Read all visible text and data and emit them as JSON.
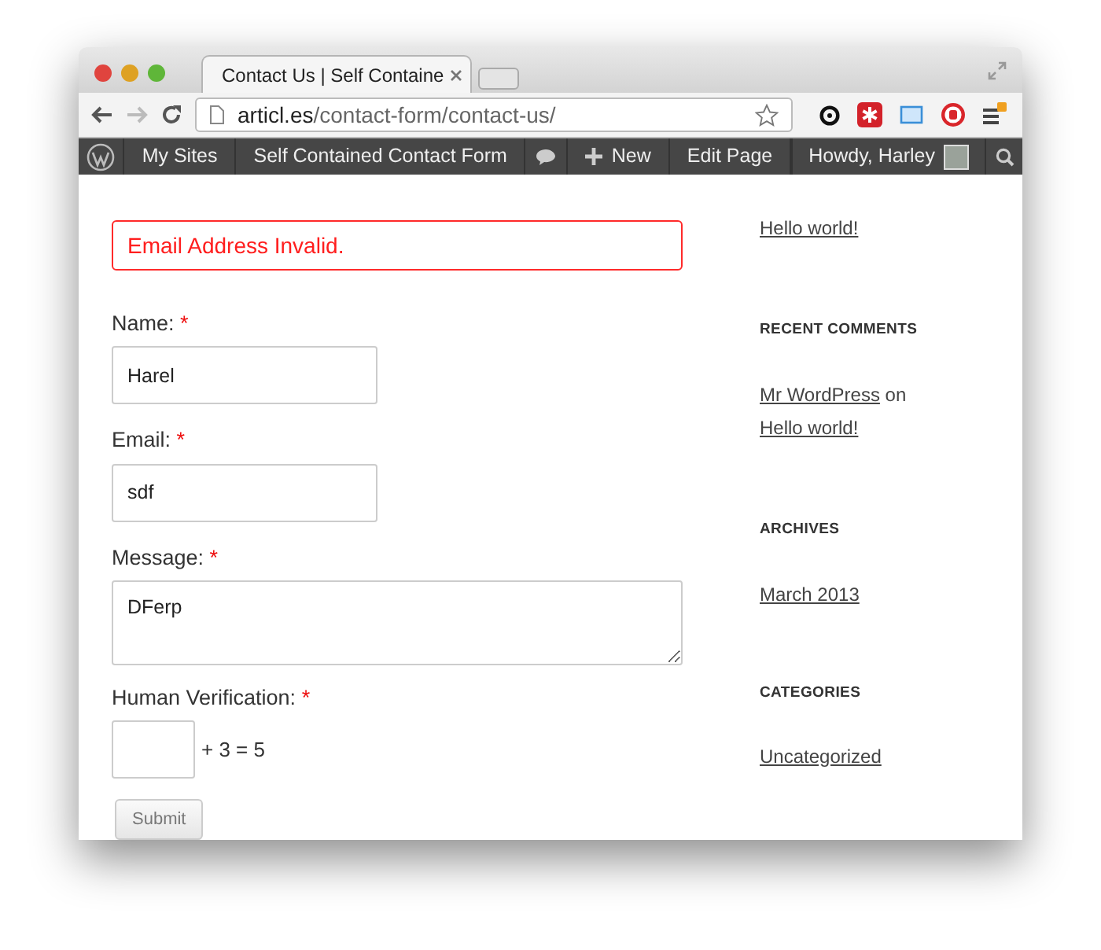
{
  "browser": {
    "tab_title": "Contact Us | Self Containe",
    "url_host": "articl.es",
    "url_path": "/contact-form/contact-us/"
  },
  "admin_bar": {
    "items": [
      {
        "kind": "logo"
      },
      {
        "kind": "text",
        "label": "My Sites"
      },
      {
        "kind": "text",
        "label": "Self Contained Contact Form"
      },
      {
        "kind": "comments"
      },
      {
        "kind": "new",
        "label": "New"
      },
      {
        "kind": "text",
        "label": "Edit Page"
      }
    ],
    "account": "Howdy, Harley"
  },
  "form": {
    "error": "Email Address Invalid.",
    "fields": [
      {
        "kind": "input",
        "label": "Name:",
        "mark": "*",
        "value": "Harel"
      },
      {
        "kind": "input",
        "label": "Email:",
        "mark": "*",
        "value": "sdf"
      },
      {
        "kind": "textarea",
        "label": "Message:",
        "mark": "*",
        "value": "DFerp"
      },
      {
        "kind": "captcha",
        "label": "Human Verification:",
        "mark": "*",
        "suffix": "+ 3 = 5"
      }
    ],
    "submit": "Submit"
  },
  "sidebar": {
    "recent_posts": [
      "Hello world!"
    ],
    "widgets": [
      {
        "title": "RECENT COMMENTS",
        "kind": "comment",
        "author": "Mr WordPress",
        "joiner": "on",
        "post": "Hello world!"
      },
      {
        "title": "ARCHIVES",
        "kind": "links",
        "links": [
          "March 2013"
        ]
      },
      {
        "title": "CATEGORIES",
        "kind": "links",
        "links": [
          "Uncategorized"
        ]
      }
    ]
  }
}
